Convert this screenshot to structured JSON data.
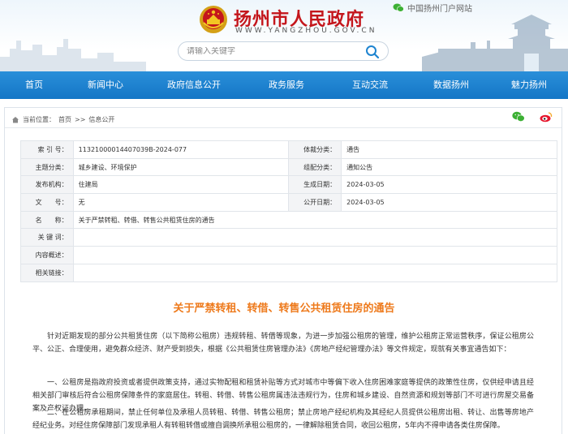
{
  "header": {
    "site_title": "扬州市人民政府",
    "site_url": "WWW.YANGZHOU.GOV.CN",
    "portal_link": "中国扬州门户网站",
    "search_placeholder": "请输入关键字"
  },
  "nav": {
    "items": [
      {
        "label": "首页"
      },
      {
        "label": "新闻中心"
      },
      {
        "label": "政府信息公开"
      },
      {
        "label": "政务服务"
      },
      {
        "label": "互动交流"
      },
      {
        "label": "数据扬州"
      },
      {
        "label": "魅力扬州"
      }
    ]
  },
  "breadcrumb": {
    "prefix": "当前位置：",
    "home": "首页",
    "sep": ">>",
    "current": "信息公开"
  },
  "meta": {
    "index_label": "索 引 号：",
    "index_value": "11321000014407039B-2024-077",
    "category_label": "体裁分类：",
    "category_value": "通告",
    "topic_label": "主题分类：",
    "topic_value": "城乡建设、环境保护",
    "issuer_label": "组配分类：",
    "issuer_value": "通知公告",
    "org_label": "发布机构：",
    "org_value": "住建局",
    "gen_date_label": "生成日期：",
    "gen_date_value": "2024-03-05",
    "doc_no_label": "文　　号：",
    "doc_no_value": "无",
    "pub_date_label": "公开日期：",
    "pub_date_value": "2024-03-05",
    "name_label": "名　　称：",
    "name_value": "关于严禁转租、转借、转售公共租赁住房的通告",
    "keywords_label": "关 键 词：",
    "keywords_value": "",
    "summary_label": "内容概述：",
    "summary_value": "",
    "links_label": "相关链接：",
    "links_value": ""
  },
  "article": {
    "title": "关于严禁转租、转借、转售公共租赁住房的通告",
    "p1": "针对近期发现的部分公共租赁住房（以下简称公租房）违规转租、转借等现象，为进一步加强公租房的管理，维护公租房正常运营秩序，保证公租房公平、公正、合理使用，避免群众经济、财产受到损失，根据《公共租赁住房管理办法》《房地产经纪管理办法》等文件规定，现就有关事宜通告如下：",
    "p2": "一、公租房是指政府投资或者提供政策支持，通过实物配租和租赁补贴等方式对城市中等偏下收入住房困难家庭等提供的政策性住房，仅供经申请且经相关部门审核后符合公租房保障条件的家庭居住。转租、转借、转售公租房属违法违规行为，住房和城乡建设、自然资源和规划等部门不可进行房屋交易备案及产权证办理。",
    "p3": "二、在公租房承租期间，禁止任何单位及承租人员转租、转借、转售公租房；禁止房地产经纪机构及其经纪人员提供公租房出租、转让、出售等房地产经纪业务。对经住房保障部门发现承租人有转租转借或擅自调换所承租公租房的，一律解除租赁合同，收回公租房，5年内不得申请各类住房保障。"
  },
  "colors": {
    "nav_bg": "#1e84d0",
    "title_red": "#c4161c",
    "article_title": "#ee7a1c"
  },
  "icons": [
    "emblem-icon",
    "wechat-icon",
    "search-icon",
    "home-icon",
    "wechat-share-icon",
    "weibo-share-icon"
  ]
}
